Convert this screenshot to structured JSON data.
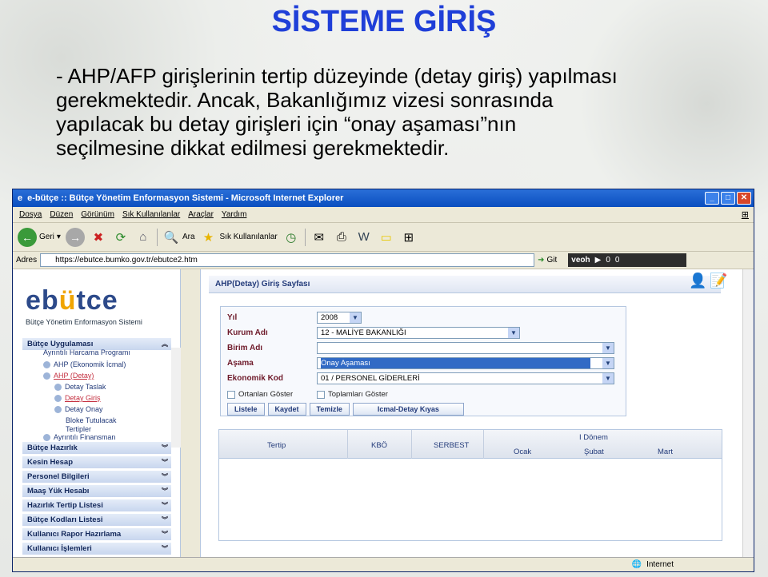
{
  "slide": {
    "title": "SİSTEME GİRİŞ",
    "lines": [
      "- AHP/AFP girişlerinin tertip düzeyinde (detay giriş) yapılması",
      "gerekmektedir. Ancak, Bakanlığımız vizesi sonrasında",
      "yapılacak bu detay girişleri için “onay aşaması”nın",
      "seçilmesine dikkat edilmesi gerekmektedir."
    ]
  },
  "browser": {
    "title": "e-bütçe :: Bütçe Yönetim Enformasyon Sistemi - Microsoft Internet Explorer",
    "menu": [
      "Dosya",
      "Düzen",
      "Görünüm",
      "Sık Kullanılanlar",
      "Araçlar",
      "Yardım"
    ],
    "back": "Geri",
    "search": "Ara",
    "favorites": "Sık Kullanılanlar",
    "address_label": "Adres",
    "address": "https://ebutce.bumko.gov.tr/ebutce2.htm",
    "go": "Git",
    "veoh": "veoh",
    "veoh_a": "0",
    "veoh_b": "0",
    "status": "Internet"
  },
  "logo": {
    "text_a": "eb",
    "text_b": "ü",
    "text_c": "tce",
    "subtitle": "Bütçe Yönetim Enformasyon Sistemi"
  },
  "sidebar": {
    "top": "Bütçe Uygulaması",
    "tree": [
      "Ayrıntılı Harcama Programı",
      "AHP (Ekonomik İcmal)",
      "AHP (Detay)",
      "Detay Taslak",
      "Detay Giriş",
      "Detay Onay",
      "Bloke Tutulacak",
      "Tertipler",
      "Ayrıntılı Finansman"
    ],
    "sections": [
      "Bütçe Hazırlık",
      "Kesin Hesap",
      "Personel Bilgileri",
      "Maaş Yük Hesabı",
      "Hazırlık Tertip Listesi",
      "Bütçe Kodları Listesi",
      "Kullanıcı Rapor Hazırlama",
      "Kullanıcı İşlemleri"
    ]
  },
  "page": {
    "header": "AHP(Detay) Giriş Sayfası",
    "fields": [
      {
        "label": "Yıl",
        "value": "2008"
      },
      {
        "label": "Kurum Adı",
        "value": "12 - MALİYE BAKANLIĞI"
      },
      {
        "label": "Birim Adı",
        "value": ""
      },
      {
        "label": "Aşama",
        "value": "Onay Aşaması"
      },
      {
        "label": "Ekonomik Kod",
        "value": "01 / PERSONEL GİDERLERİ"
      }
    ],
    "checks": [
      "Ortanları Göster",
      "Toplamları Göster"
    ],
    "buttons": [
      "Listele",
      "Kaydet",
      "Temizle",
      "Icmal-Detay Kıyas"
    ],
    "grid": {
      "tertip": "Tertip",
      "kbo": "KBÖ",
      "serbest": "SERBEST",
      "period": "I Dönem",
      "months": [
        "Ocak",
        "Şubat",
        "Mart"
      ]
    }
  }
}
